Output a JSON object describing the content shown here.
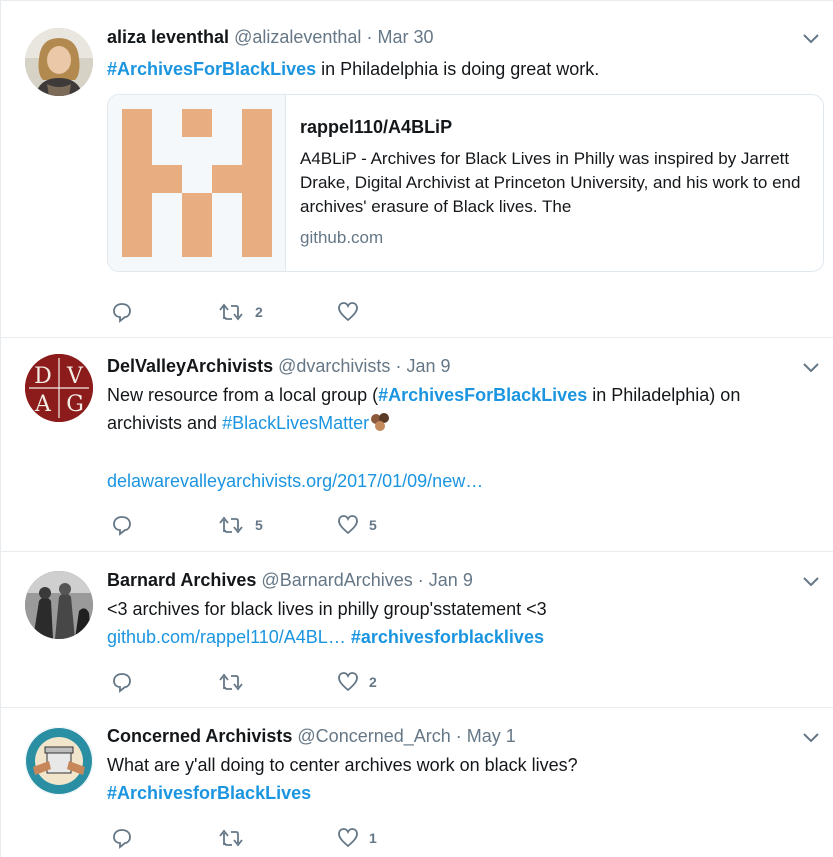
{
  "tweets": [
    {
      "name": "aliza leventhal",
      "handle": "@alizaleventhal",
      "sep": "·",
      "date": "Mar 30",
      "hashtag1": "#ArchivesForBlackLives",
      "text1": " in Philadelphia is doing great work.",
      "card": {
        "title": "rappel110/A4BLiP",
        "description": "A4BLiP - Archives for Black Lives in Philly was inspired by Jarrett Drake, Digital Archivist at Princeton University, and his work to end archives' erasure of Black lives. The",
        "domain": "github.com",
        "logo_color": "#e8ae82"
      },
      "retweets": "2",
      "likes": ""
    },
    {
      "name": "DelValleyArchivists",
      "handle": "@dvarchivists",
      "sep": "·",
      "date": "Jan 9",
      "text1": "New resource from a local group (",
      "hashtag1": "#ArchivesForBlackLives",
      "text2": " in Philadelphia) on archivists and ",
      "hashtag2": "#BlackLivesMatter",
      "link": "delawarevalleyarchivists.org/2017/01/09/new…",
      "avatar_letters": [
        "D",
        "V",
        "A",
        "G"
      ],
      "retweets": "5",
      "likes": "5"
    },
    {
      "name": "Barnard Archives",
      "handle": "@BarnardArchives",
      "sep": "·",
      "date": "Jan 9",
      "text1": "<3 archives for black lives in philly group'sstatement <3",
      "link": "github.com/rappel110/A4BL…",
      "hashtag1": "#archivesforblacklives",
      "retweets": "",
      "likes": "2"
    },
    {
      "name": "Concerned Archivists",
      "handle": "@Concerned_Arch",
      "sep": "·",
      "date": "May 1",
      "text1": "What are y'all doing to center archives work on black lives?",
      "hashtag1": "#ArchivesforBlackLives",
      "retweets": "",
      "likes": "1"
    }
  ],
  "colors": {
    "link": "#1b95e0",
    "muted": "#657786",
    "text": "#14171a",
    "border": "#e6ecf0"
  },
  "icons": {
    "reply": "reply-icon",
    "retweet": "retweet-icon",
    "like": "heart-icon",
    "more": "chevron-down-icon"
  }
}
